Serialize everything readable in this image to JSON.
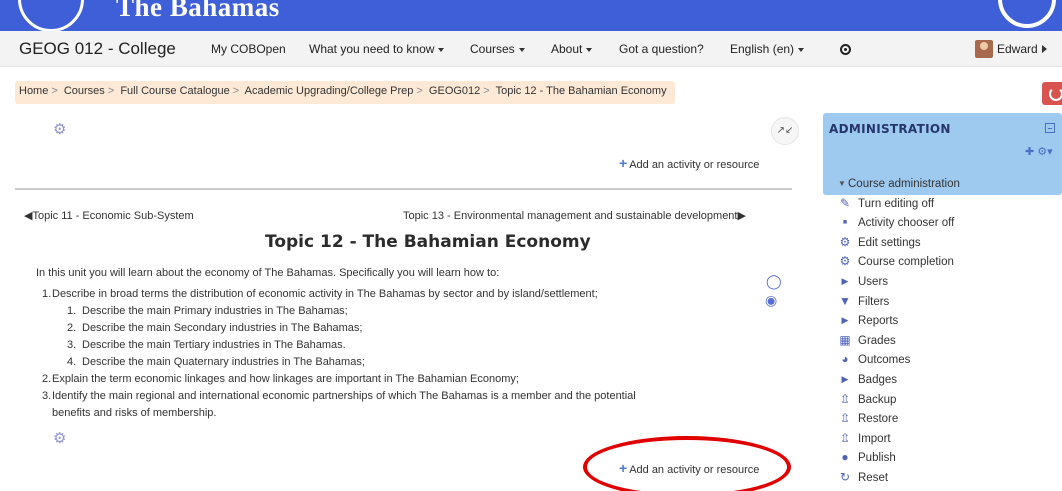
{
  "banner": {
    "org_name": "The Bahamas"
  },
  "navbar": {
    "brand": "GEOG 012 - College",
    "items": [
      {
        "label": "My COBOpen",
        "dropdown": false
      },
      {
        "label": "What you need to know",
        "dropdown": true
      },
      {
        "label": "Courses",
        "dropdown": true
      },
      {
        "label": "About",
        "dropdown": true
      },
      {
        "label": "Got a question?",
        "dropdown": false
      },
      {
        "label": "English (en)",
        "dropdown": true
      }
    ],
    "user_name": "Edward"
  },
  "breadcrumb": [
    "Home",
    "Courses",
    "Full Course Catalogue",
    "Academic Upgrading/College Prep",
    "GEOG012",
    "Topic 12 - The Bahamian Economy"
  ],
  "main": {
    "add_activity_label": "Add an activity or resource",
    "prev_topic": "Topic 11 - Economic Sub-System",
    "next_topic": "Topic 13 - Environmental management and sustainable development",
    "section_title": "Topic 12 - The Bahamian Economy",
    "intro": "In this unit you will learn about the economy of The Bahamas. Specifically you will learn how to:",
    "objectives": [
      {
        "num": "1.",
        "text": "Describe in broad terms the distribution of economic activity in The Bahamas by sector and by island/settlement;",
        "sub": [
          {
            "num": "1.",
            "text": "Describe the main Primary industries in The Bahamas;"
          },
          {
            "num": "2.",
            "text": "Describe the main Secondary industries in The Bahamas;"
          },
          {
            "num": "3.",
            "text": "Describe the main Tertiary industries in The Bahamas."
          },
          {
            "num": "4.",
            "text": "Describe the main Quaternary industries in The Bahamas;"
          }
        ]
      },
      {
        "num": "2.",
        "text": "Explain the term economic linkages and how linkages are important in The Bahamian Economy;"
      },
      {
        "num": "3.",
        "text": "Identify the main regional and international economic partnerships of which The Bahamas is a member and the potential",
        "text2": "benefits and risks of membership."
      }
    ]
  },
  "administration": {
    "title": "ADMINISTRATION",
    "items": [
      {
        "label": "Course administration",
        "icon": "triangle-down-icon"
      },
      {
        "label": "Turn editing off",
        "icon": "pencil-icon"
      },
      {
        "label": "Activity chooser off",
        "icon": "square-bullet-icon"
      },
      {
        "label": "Edit settings",
        "icon": "gear-icon"
      },
      {
        "label": "Course completion",
        "icon": "gear-icon"
      },
      {
        "label": "Users",
        "icon": "triangle-right-icon"
      },
      {
        "label": "Filters",
        "icon": "filter-icon"
      },
      {
        "label": "Reports",
        "icon": "triangle-right-icon"
      },
      {
        "label": "Grades",
        "icon": "table-icon"
      },
      {
        "label": "Outcomes",
        "icon": "pie-icon"
      },
      {
        "label": "Badges",
        "icon": "triangle-right-icon"
      },
      {
        "label": "Backup",
        "icon": "upload-icon"
      },
      {
        "label": "Restore",
        "icon": "upload-icon"
      },
      {
        "label": "Import",
        "icon": "upload-icon"
      },
      {
        "label": "Publish",
        "icon": "globe-icon"
      },
      {
        "label": "Reset",
        "icon": "refresh-icon"
      }
    ]
  },
  "colors": {
    "banner": "#3e5fd8",
    "breadcrumb_bg": "#fde9d6",
    "admin_header": "#9fcaf0",
    "power_button": "#d9534f",
    "annotation": "#e00000"
  }
}
